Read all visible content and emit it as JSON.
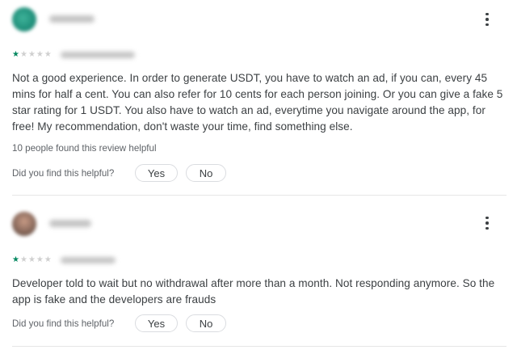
{
  "reviews": [
    {
      "rating": 1,
      "rating_max": 5,
      "text": "Not a good experience. In order to generate USDT, you have to watch an ad, if you can, every 45 mins for half a cent. You can also refer for 10 cents for each person joining. Or you can give a fake 5 star rating for 1 USDT. You also have to watch an ad, everytime you navigate around the app, for free! My recommendation, don't waste your time, find something else.",
      "helpful_count_text": "10 people found this review helpful",
      "helpful_question": "Did you find this helpful?",
      "yes_label": "Yes",
      "no_label": "No"
    },
    {
      "rating": 1,
      "rating_max": 5,
      "text": "Developer told to wait but no withdrawal after more than a month. Not responding anymore. So the app is fake and the developers are frauds",
      "helpful_question": "Did you find this helpful?",
      "yes_label": "Yes",
      "no_label": "No"
    }
  ],
  "icons": {
    "more": "more-vert-icon",
    "star": "star-icon"
  },
  "colors": {
    "star_filled": "#01875f",
    "star_empty": "#d0d0d0",
    "text": "#3c4043",
    "secondary_text": "#5f6368",
    "divider": "#e6e6e6"
  }
}
